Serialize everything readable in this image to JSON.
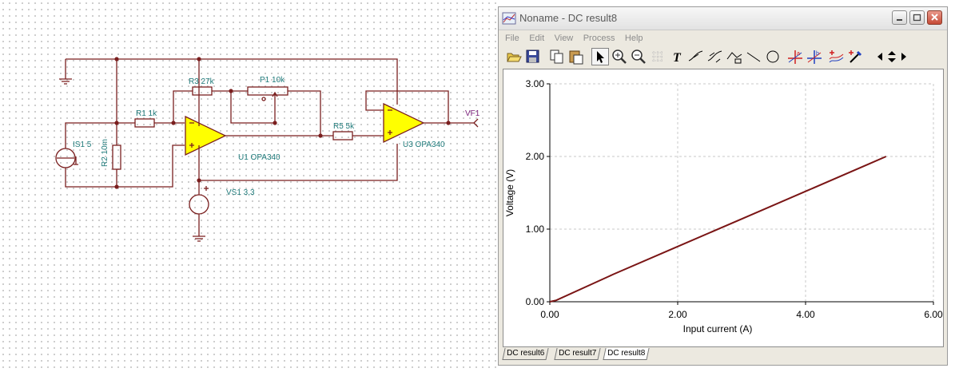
{
  "schematic": {
    "labels": {
      "r3": "R3 27k",
      "p1": "P1 10k",
      "r1": "R1 1k",
      "r5": "R5 5k",
      "is1": "IS1 5",
      "r2": "R2 10m",
      "u1": "U1 OPA340",
      "u3": "U3 OPA340",
      "vs1": "VS1 3,3",
      "vf1": "VF1"
    }
  },
  "window": {
    "title": "Noname - DC result8",
    "menu": [
      "File",
      "Edit",
      "View",
      "Process",
      "Help"
    ],
    "tabs": [
      "DC result6",
      "DC result7",
      "DC result8"
    ],
    "active_tab": "DC result8",
    "colors": {
      "trace": "#7a1515",
      "grid": "#c8c8c8"
    },
    "icons": [
      "open-icon",
      "save-icon",
      "copy-icon",
      "paste-icon",
      "pointer-icon",
      "zoom-in-icon",
      "zoom-out-icon",
      "grid-icon",
      "text-icon",
      "curve-label-icon",
      "curve-label2-icon",
      "curve-label3-icon",
      "line-icon",
      "circle-icon",
      "cursor-a-icon",
      "cursor-b-icon",
      "add-curve-icon",
      "probe-icon",
      "arrow-left-icon",
      "arrow-updown-icon",
      "arrow-right-icon"
    ]
  },
  "chart_data": {
    "type": "line",
    "title": "",
    "xlabel": "Input current (A)",
    "ylabel": "Voltage (V)",
    "xlim": [
      0,
      6
    ],
    "ylim": [
      0,
      3
    ],
    "xticks": [
      "0.00",
      "2.00",
      "4.00",
      "6.00"
    ],
    "yticks": [
      "0.00",
      "1.00",
      "2.00",
      "3.00"
    ],
    "grid": true,
    "series": [
      {
        "x": [
          0,
          0.1,
          1,
          2,
          3,
          4,
          5,
          5.26
        ],
        "y": [
          0,
          0.02,
          0.38,
          0.76,
          1.14,
          1.52,
          1.9,
          2.0
        ]
      }
    ]
  }
}
